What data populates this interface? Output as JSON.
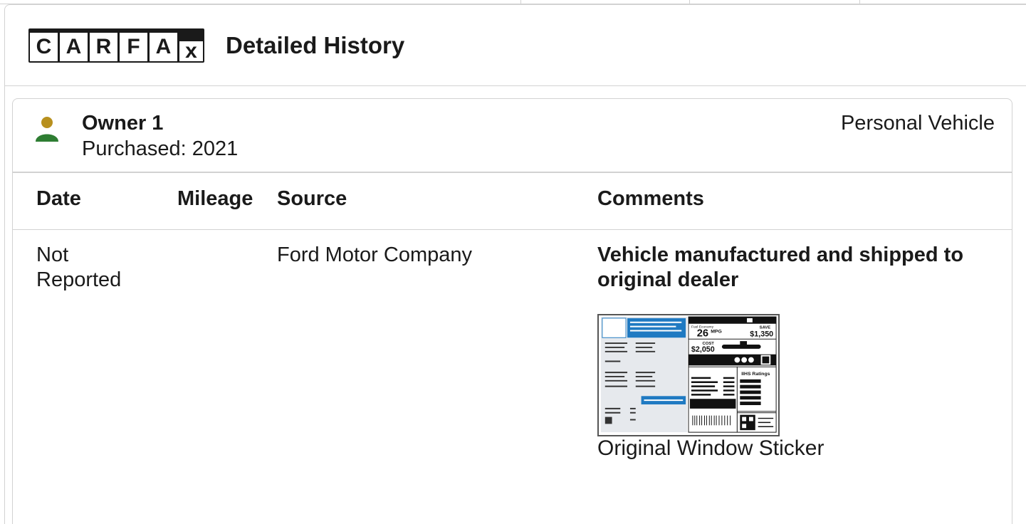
{
  "brand": {
    "logo_letters": [
      "C",
      "A",
      "R",
      "F",
      "A",
      "x"
    ]
  },
  "header": {
    "title": "Detailed History"
  },
  "owner": {
    "title": "Owner 1",
    "purchased": "Purchased: 2021",
    "type": "Personal Vehicle",
    "icon": "person-icon"
  },
  "table": {
    "columns": [
      "Date",
      "Mileage",
      "Source",
      "Comments"
    ],
    "rows": [
      {
        "date_line1": "Not",
        "date_line2": "Reported",
        "mileage": "",
        "source": "Ford Motor Company",
        "comment_line1": "Vehicle manufactured and shipped to",
        "comment_line2": "original dealer",
        "attachment_label": "Original Window Sticker"
      }
    ]
  },
  "sticker": {
    "fuel_label": "Fuel Economy",
    "mpg": "26",
    "mpg_unit": "MPG",
    "save_label": "SAVE",
    "save_amount": "$1,350",
    "cost_label": "COST",
    "cost_amount": "$2,050",
    "ratings_label": "IIHS Ratings"
  },
  "colors": {
    "accent_blue": "#1f7ac2",
    "person_head": "#b8901e",
    "person_body": "#2e7d32",
    "border": "#d2d2d2"
  }
}
